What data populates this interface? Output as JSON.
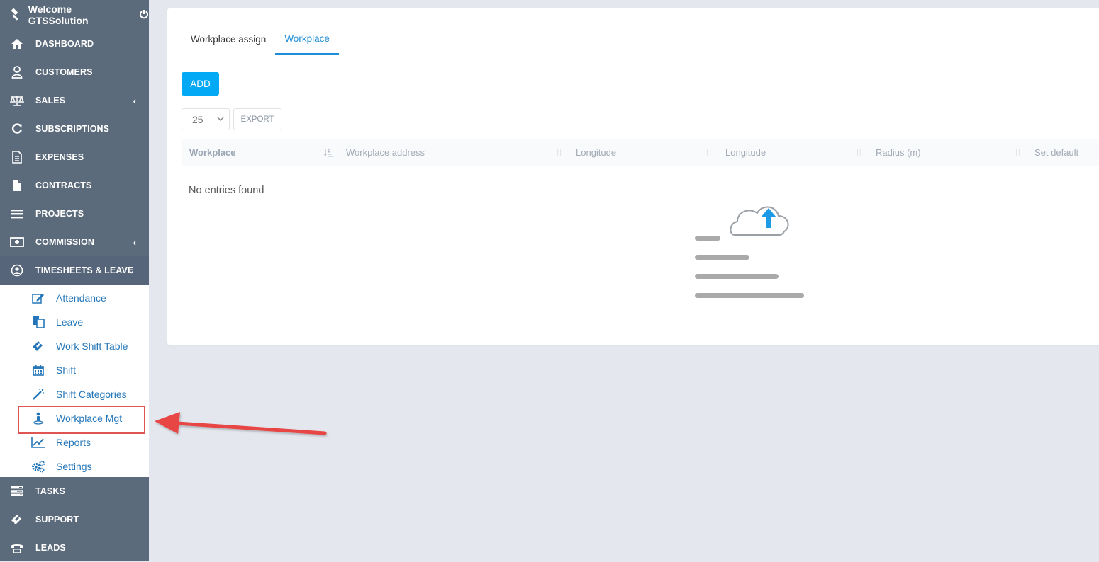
{
  "sidebar": {
    "header": {
      "title": "Welcome GTSSolution"
    },
    "menu": [
      {
        "label": "DASHBOARD",
        "icon": "home-icon"
      },
      {
        "label": "CUSTOMERS",
        "icon": "user-icon"
      },
      {
        "label": "SALES",
        "icon": "balance-scale-icon"
      },
      {
        "label": "SUBSCRIPTIONS",
        "icon": "refresh-icon"
      },
      {
        "label": "EXPENSES",
        "icon": "file-text-icon"
      },
      {
        "label": "CONTRACTS",
        "icon": "file-icon"
      },
      {
        "label": "PROJECTS",
        "icon": "bars-icon"
      },
      {
        "label": "COMMISSION",
        "icon": "money-icon"
      },
      {
        "label": "TIMESHEETS & LEAVE",
        "icon": "user-circle-icon"
      }
    ],
    "submenu": [
      {
        "label": "Attendance",
        "icon": "edit-icon"
      },
      {
        "label": "Leave",
        "icon": "copy-icon"
      },
      {
        "label": "Work Shift Table",
        "icon": "ticket-icon"
      },
      {
        "label": "Shift",
        "icon": "calendar-icon"
      },
      {
        "label": "Shift Categories",
        "icon": "magic-wand-icon"
      },
      {
        "label": "Workplace Mgt",
        "icon": "map-pin-person-icon"
      },
      {
        "label": "Reports",
        "icon": "line-chart-icon"
      },
      {
        "label": "Settings",
        "icon": "cogs-icon"
      }
    ],
    "menu_bottom": [
      {
        "label": "TASKS",
        "icon": "tasks-icon"
      },
      {
        "label": "SUPPORT",
        "icon": "ticket-icon"
      },
      {
        "label": "LEADS",
        "icon": "phone-icon"
      }
    ]
  },
  "main": {
    "tabs": [
      {
        "label": "Workplace assign"
      },
      {
        "label": "Workplace"
      }
    ],
    "add_label": "ADD",
    "page_length": "25",
    "export_label": "EXPORT",
    "columns": [
      "Workplace",
      "Workplace address",
      "Longitude",
      "Longitude",
      "Radius (m)",
      "Set default"
    ],
    "empty_message": "No entries found"
  },
  "colors": {
    "sidebar_bg": "#5c6b7b",
    "accent": "#03a9f4",
    "link": "#2476b8",
    "annotation": "#e05454"
  }
}
